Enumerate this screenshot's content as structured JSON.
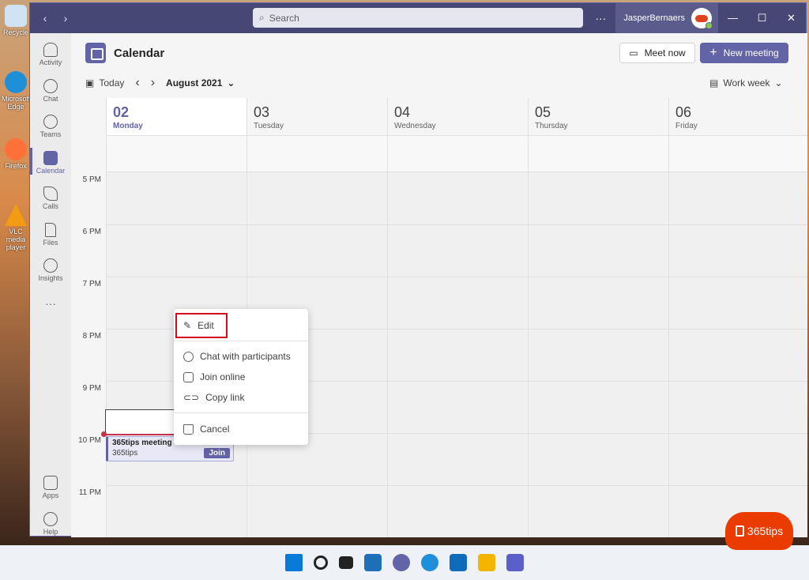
{
  "desktop": {
    "icons": [
      {
        "label": "Recycle",
        "color": "#5a9bd5"
      },
      {
        "label": "Microsoft Edge",
        "color": "#1e8fd8"
      },
      {
        "label": "Firefox",
        "color": "#ff7139"
      },
      {
        "label": "VLC media player",
        "color": "#f39c12"
      }
    ]
  },
  "titlebar": {
    "search_placeholder": "Search",
    "more": "···",
    "user_name": "JasperBernaers",
    "controls": [
      "—",
      "☐",
      "✕"
    ]
  },
  "rail": {
    "items": [
      {
        "label": "Activity",
        "icon": "bell-icon",
        "active": false
      },
      {
        "label": "Chat",
        "icon": "chat-icon",
        "active": false
      },
      {
        "label": "Teams",
        "icon": "teams-icon",
        "active": false
      },
      {
        "label": "Calendar",
        "icon": "calendar-icon",
        "active": true
      },
      {
        "label": "Calls",
        "icon": "phone-icon",
        "active": false
      },
      {
        "label": "Files",
        "icon": "file-icon",
        "active": false
      },
      {
        "label": "Insights",
        "icon": "insights-icon",
        "active": false
      }
    ],
    "more": "···",
    "bottom": [
      {
        "label": "Apps",
        "icon": "apps-icon"
      },
      {
        "label": "Help",
        "icon": "help-icon"
      }
    ]
  },
  "header": {
    "title": "Calendar",
    "meet_now": "Meet now",
    "new_meeting": "New meeting",
    "today": "Today",
    "month": "August 2021",
    "view": "Work week"
  },
  "calendar": {
    "days": [
      {
        "num": "02",
        "name": "Monday",
        "today": true
      },
      {
        "num": "03",
        "name": "Tuesday",
        "today": false
      },
      {
        "num": "04",
        "name": "Wednesday",
        "today": false
      },
      {
        "num": "05",
        "name": "Thursday",
        "today": false
      },
      {
        "num": "06",
        "name": "Friday",
        "today": false
      }
    ],
    "hours": [
      "5 PM",
      "6 PM",
      "7 PM",
      "8 PM",
      "9 PM",
      "10 PM",
      "11 PM"
    ],
    "event": {
      "title": "365tips meeting",
      "organizer": "365tips",
      "join": "Join"
    }
  },
  "context_menu": {
    "edit": "Edit",
    "chat": "Chat with participants",
    "join": "Join online",
    "copy": "Copy link",
    "cancel": "Cancel"
  },
  "brand": {
    "text": "365tips"
  },
  "colors": {
    "accent": "#6264a7",
    "titlebar": "#464775",
    "highlight": "#d40a1d"
  }
}
